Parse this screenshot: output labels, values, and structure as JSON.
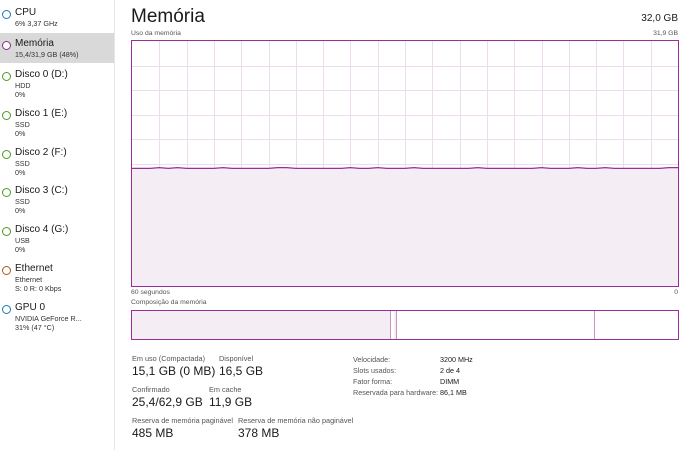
{
  "sidebar": {
    "items": [
      {
        "title": "CPU",
        "lines": [
          "6% 3,37 GHz"
        ],
        "color": "#1a7ab0"
      },
      {
        "title": "Memória",
        "lines": [
          "15,4/31,9 GB (48%)"
        ],
        "color": "#8b2a8b"
      },
      {
        "title": "Disco 0 (D:)",
        "lines": [
          "HDD",
          "0%"
        ],
        "color": "#4a9a1c"
      },
      {
        "title": "Disco 1 (E:)",
        "lines": [
          "SSD",
          "0%"
        ],
        "color": "#4a9a1c"
      },
      {
        "title": "Disco 2 (F:)",
        "lines": [
          "SSD",
          "0%"
        ],
        "color": "#4a9a1c"
      },
      {
        "title": "Disco 3 (C:)",
        "lines": [
          "SSD",
          "0%"
        ],
        "color": "#4a9a1c"
      },
      {
        "title": "Disco 4 (G:)",
        "lines": [
          "USB",
          "0%"
        ],
        "color": "#4a9a1c"
      },
      {
        "title": "Ethernet",
        "lines": [
          "Ethernet",
          "S: 0 R: 0 Kbps"
        ],
        "color": "#a7571a"
      },
      {
        "title": "GPU 0",
        "lines": [
          "NVIDIA GeForce R...",
          "31% (47 °C)"
        ],
        "color": "#1a7ab0"
      }
    ]
  },
  "main": {
    "title": "Memória",
    "total": "32,0 GB",
    "usage_label": "Uso da memória",
    "usage_max": "31,9 GB",
    "time_left": "60 segundos",
    "time_right": "0",
    "composition_label": "Composição da memória",
    "accent_color": "#9b2d9b",
    "usage_fraction": 0.48
  },
  "stats": {
    "in_use_label": "Em uso (Compactada)",
    "in_use_value": "15,1 GB (0 MB)",
    "available_label": "Disponível",
    "available_value": "16,5 GB",
    "committed_label": "Confirmado",
    "committed_value": "25,4/62,9 GB",
    "cached_label": "Em cache",
    "cached_value": "11,9 GB",
    "paged_label": "Reserva de memória paginável",
    "paged_value": "485 MB",
    "nonpaged_label": "Reserva de memória não paginável",
    "nonpaged_value": "378 MB"
  },
  "details": [
    {
      "key": "Velocidade:",
      "value": "3200 MHz"
    },
    {
      "key": "Slots usados:",
      "value": "2 de 4"
    },
    {
      "key": "Fator forma:",
      "value": "DIMM"
    },
    {
      "key": "Reservada para hardware:",
      "value": "86,1 MB"
    }
  ]
}
